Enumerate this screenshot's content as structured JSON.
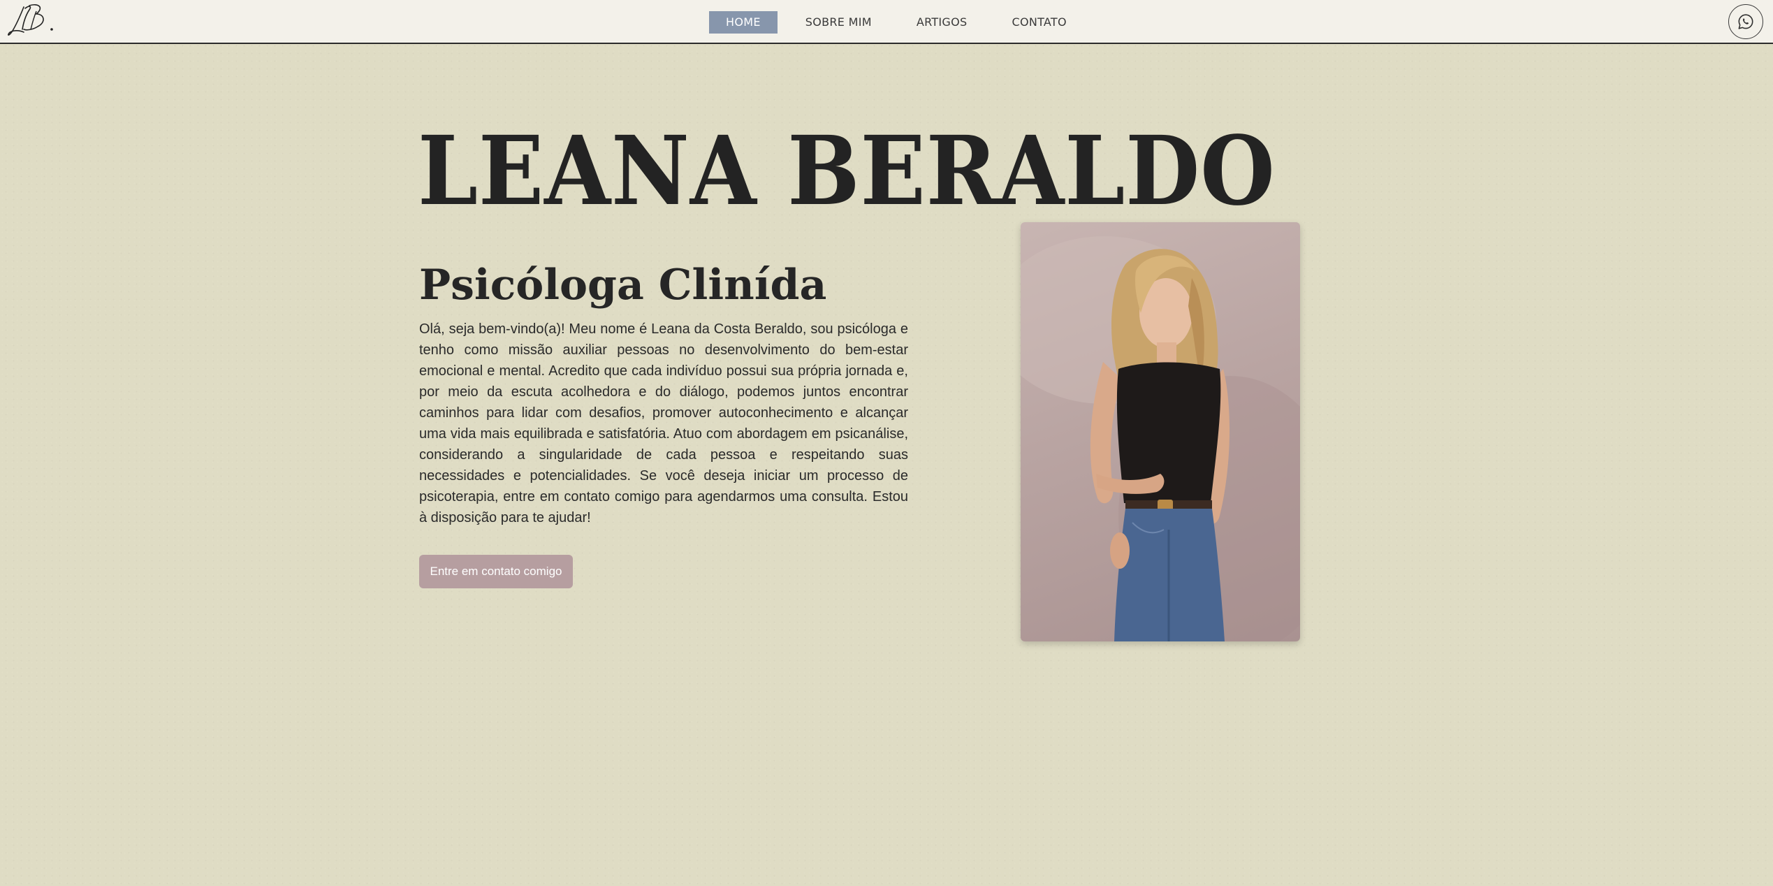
{
  "brand": {
    "logo_text": "LB."
  },
  "nav": {
    "items": [
      {
        "label": "HOME",
        "active": true
      },
      {
        "label": "SOBRE MIM",
        "active": false
      },
      {
        "label": "ARTIGOS",
        "active": false
      },
      {
        "label": "CONTATO",
        "active": false
      }
    ],
    "whatsapp_icon": "whatsapp-icon"
  },
  "hero": {
    "name": "LEANA BERALDO",
    "subtitle": "Psicóloga Clinída",
    "bio": "Olá, seja bem-vindo(a)! Meu nome é Leana da Costa Beraldo, sou psicóloga e tenho como missão auxiliar pessoas no desenvolvimento do bem-estar emocional e mental. Acredito que cada indivíduo possui sua própria jornada e, por meio da escuta acolhedora e do diálogo, podemos juntos encontrar caminhos para lidar com desafios, promover autoconhecimento e alcançar uma vida mais equilibrada e satisfatória. Atuo com abordagem em psicanálise, considerando a singularidade de cada pessoa e respeitando suas necessidades e potencialidades. Se você deseja iniciar um processo de psicoterapia, entre em contato comigo para agendarmos uma consulta. Estou à disposição para te ajudar!",
    "cta_label": "Entre em contato comigo"
  },
  "colors": {
    "background": "#dfdcc4",
    "navbar": "#f3f1ea",
    "nav_active": "#8796ac",
    "cta": "#b69ea0",
    "text_dark": "#232323"
  }
}
